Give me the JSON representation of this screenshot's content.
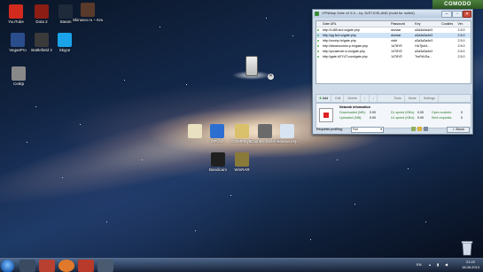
{
  "desktop": {
    "icons": [
      {
        "label": "YouTube",
        "color": "#d32a1e",
        "icon": "youtube-icon"
      },
      {
        "label": "Dota 2",
        "color": "#8b1d14",
        "icon": "dota2-icon"
      },
      {
        "label": "Steam",
        "color": "#1e2a3a",
        "icon": "steam-icon"
      },
      {
        "label": "Skinwoo.ru – Кликни",
        "color": "#5a3a2a",
        "icon": "game-shortcut-icon"
      },
      {
        "label": "VegasPro",
        "color": "#2a4d8c",
        "icon": "vegas-icon"
      },
      {
        "label": "Battlefield 3",
        "color": "#3a3a3a",
        "icon": "battlefield-icon"
      },
      {
        "label": "Skype",
        "color": "#1aa3e8",
        "icon": "skype-icon"
      },
      {
        "label": "Сейф",
        "color": "#888888",
        "icon": "safe-icon"
      }
    ],
    "center_icons": [
      {
        "label": "",
        "color": "#e8e0c0",
        "icon": "file-icon"
      },
      {
        "label": "GPU-Z",
        "color": "#2c6fd1",
        "icon": "gpu-icon"
      },
      {
        "label": "GOMPlayer",
        "color": "#d9c06a",
        "icon": "gom-icon"
      },
      {
        "label": "Counter-Strike Source",
        "color": "#6a6a6a",
        "icon": "gun-icon"
      },
      {
        "label": "Компьютер",
        "color": "#d8e4f2",
        "icon": "computer-icon"
      },
      {
        "label": "Bandicam",
        "color": "#1f1f1f",
        "icon": "bandicam-icon"
      },
      {
        "label": "WinRAR",
        "color": "#8a7a3a",
        "icon": "archive-icon"
      }
    ]
  },
  "comodo": {
    "label": "COMODO"
  },
  "window": {
    "title": "VPNMap Gate v2.5.0 – by JUSTICELAND (build for nulled)",
    "columns": [
      "Gate URL",
      "Password",
      "Key",
      "Cookies",
      "Ver."
    ],
    "rows": [
      {
        "url": "http://1485.tsd.ru/gate.php",
        "password": "durstar",
        "key": "a3a3a3a4e3",
        "cookies": "",
        "ver": "2.5.0",
        "selected": false
      },
      {
        "url": "http://qq.fsd.ru/gate.php",
        "password": "durstar",
        "key": "a3a3a3a4e3",
        "cookies": "",
        "ver": "2.5.0",
        "selected": true
      },
      {
        "url": "http://cnnhp.hr/gate.php",
        "password": "xtdrt",
        "key": "a3a3a3a4e3",
        "cookies": "",
        "ver": "2.5.0",
        "selected": false
      },
      {
        "url": "http://dreamcorner.p.hr/gate.php",
        "password": "1478YE",
        "key": "HU7jfuf4...",
        "cookies": "",
        "ver": "2.5.0",
        "selected": false
      },
      {
        "url": "http://youserver.ci.eu/gate.php",
        "password": "1478YE",
        "key": "a3a3a3a4e3",
        "cookies": "",
        "ver": "2.5.0",
        "selected": false
      },
      {
        "url": "http://gate.ld7Y4T.com/gate.php",
        "password": "1478YE",
        "key": "TrsFdUSa...",
        "cookies": "",
        "ver": "2.5.0",
        "selected": false
      }
    ],
    "toolbar": {
      "add": "Add",
      "edit": "Edit",
      "delete": "Delete",
      "up": "↑",
      "down": "↓",
      "tools": "Tools",
      "mode": "Mode",
      "settings": "Settings"
    },
    "network": {
      "heading": "Network information",
      "downloaded_label": "Downloaded (MB):",
      "downloaded_value": "0.00",
      "uploaded_label": "Uploaded (MB):",
      "uploaded_value": "0.00",
      "dl_speed_label": "DL speed (KB/s):",
      "dl_speed_value": "0.00",
      "ul_speed_label": "UL speed (KB/s):",
      "ul_speed_value": "0.00",
      "open_sockets_label": "Open sockets:",
      "open_sockets_value": "0",
      "sent_requests_label": "Sent requests:",
      "sent_requests_value": "0"
    },
    "profiling_label": "Requests profiling:",
    "profiling_value": "Full",
    "about": "About"
  },
  "taskbar": {
    "lang": "EN",
    "time": "21:22",
    "date": "18.08.2013"
  }
}
